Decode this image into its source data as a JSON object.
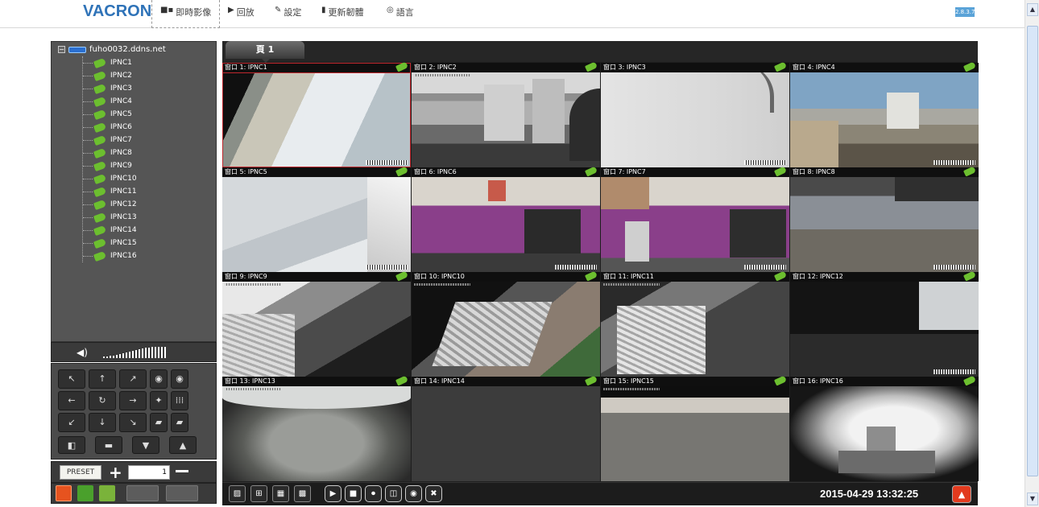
{
  "brand": "VACRON",
  "nav": [
    {
      "label": "即時影像",
      "icon": "camera-icon",
      "glyph": "■▪",
      "active": true
    },
    {
      "label": "回放",
      "icon": "play-icon",
      "glyph": "▶",
      "active": false
    },
    {
      "label": "設定",
      "icon": "wrench-icon",
      "glyph": "✎",
      "active": false
    },
    {
      "label": "更新韌體",
      "icon": "document-icon",
      "glyph": "▮",
      "active": false
    },
    {
      "label": "語言",
      "icon": "globe-icon",
      "glyph": "◎",
      "active": false
    }
  ],
  "version": "2.8.3.7",
  "device_tree": {
    "root": "fuho0032.ddns.net",
    "cameras": [
      "IPNC1",
      "IPNC2",
      "IPNC3",
      "IPNC4",
      "IPNC5",
      "IPNC6",
      "IPNC7",
      "IPNC8",
      "IPNC9",
      "IPNC10",
      "IPNC11",
      "IPNC12",
      "IPNC13",
      "IPNC14",
      "IPNC15",
      "IPNC16"
    ]
  },
  "ptz": {
    "buttons": [
      "↖",
      "↑",
      "↗",
      "◉",
      "◉",
      "←",
      "↻",
      "→",
      "✦",
      "⁞⁞⁞",
      "↙",
      "↓",
      "↘",
      "▰",
      "▰"
    ],
    "row2": [
      "◧",
      "▬",
      "▼",
      "▲"
    ]
  },
  "preset": {
    "label": "PRESET",
    "plus": "+",
    "value": "1"
  },
  "page_tab": "頁 1",
  "windows": [
    {
      "title": "窗口 1: IPNC1"
    },
    {
      "title": "窗口 2: IPNC2"
    },
    {
      "title": "窗口 3: IPNC3"
    },
    {
      "title": "窗口 4: IPNC4"
    },
    {
      "title": "窗口 5: IPNC5"
    },
    {
      "title": "窗口 6: IPNC6"
    },
    {
      "title": "窗口 7: IPNC7"
    },
    {
      "title": "窗口 8: IPNC8"
    },
    {
      "title": "窗口 9: IPNC9"
    },
    {
      "title": "窗口 10: IPNC10"
    },
    {
      "title": "窗口 11: IPNC11"
    },
    {
      "title": "窗口 12: IPNC12"
    },
    {
      "title": "窗口 13: IPNC13"
    },
    {
      "title": "窗口 14: IPNC14"
    },
    {
      "title": "窗口 15: IPNC15"
    },
    {
      "title": "窗口 16: IPNC16"
    }
  ],
  "toolbar": {
    "buttons": [
      "▨",
      "⊞",
      "▦",
      "▩",
      "▶",
      "■",
      "⏺",
      "◫",
      "◉",
      "✖"
    ],
    "clock": "2015-04-29 13:32:25",
    "up": "▲"
  },
  "colors": {
    "accent": "#2f73b8",
    "panel": "#555555",
    "selected": "#c0272d",
    "cam_ok": "#6cbf2f"
  }
}
